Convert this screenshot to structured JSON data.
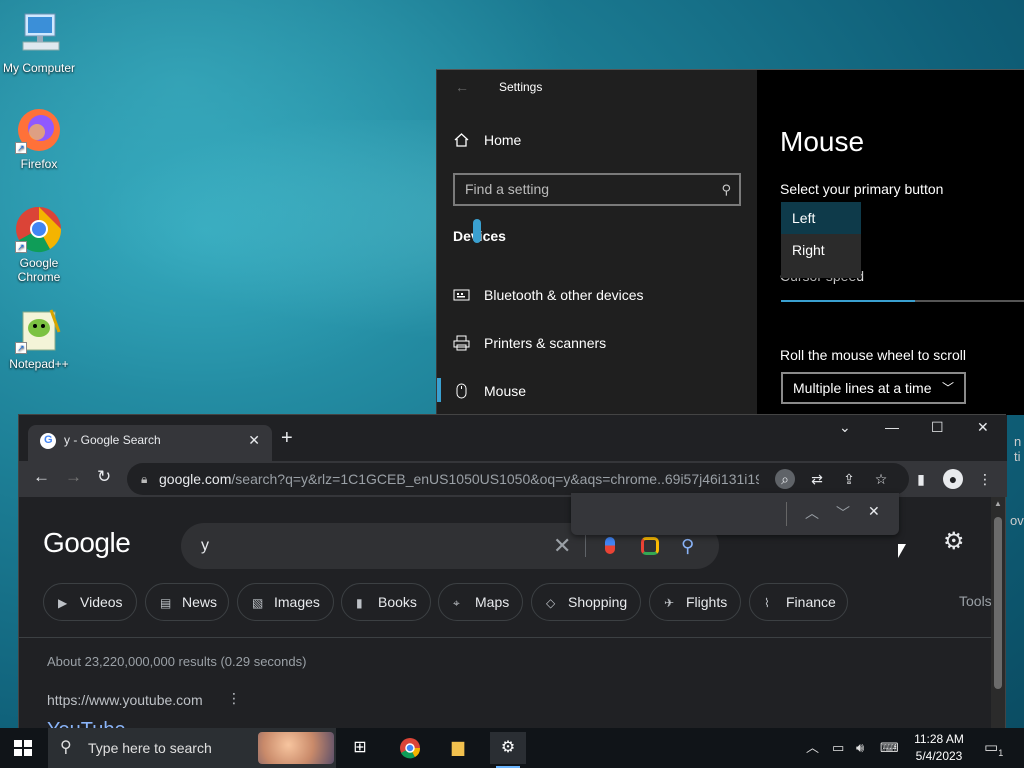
{
  "desktop": {
    "icons": [
      {
        "label": "My Computer"
      },
      {
        "label": "Firefox"
      },
      {
        "label": "Google Chrome"
      },
      {
        "label": "Notepad++"
      }
    ]
  },
  "settings": {
    "title": "Settings",
    "home_label": "Home",
    "search_placeholder": "Find a setting",
    "section": "Devices",
    "nav_items": [
      {
        "label": "Bluetooth & other devices"
      },
      {
        "label": "Printers & scanners"
      },
      {
        "label": "Mouse"
      }
    ],
    "page_title": "Mouse",
    "primary_button_label": "Select your primary button",
    "primary_button_options": [
      "Left",
      "Right"
    ],
    "cursor_speed_label": "Cursor speed",
    "cursor_speed_level": 0.55,
    "scroll_label": "Roll the mouse wheel to scroll",
    "scroll_value": "Multiple lines at a time",
    "peek_1": "n ti",
    "peek_2": "ov"
  },
  "chrome": {
    "tab_title": "y - Google Search",
    "url_host": "google.com",
    "url_path": "/search?q=y&rlz=1C1GCEB_enUS1050US1050&oq=y&aqs=chrome..69i57j46i131i19...",
    "google_logo": "Google",
    "query": "y",
    "chips": [
      "Videos",
      "News",
      "Images",
      "Books",
      "Maps",
      "Shopping",
      "Flights",
      "Finance"
    ],
    "tools_label": "Tools",
    "stats": "About 23,220,000,000 results (0.29 seconds)",
    "result_url": "https://www.youtube.com",
    "result_title": "YouTube"
  },
  "taskbar": {
    "search_placeholder": "Type here to search",
    "time": "11:28 AM",
    "date": "5/4/2023",
    "notification_count": "1"
  }
}
